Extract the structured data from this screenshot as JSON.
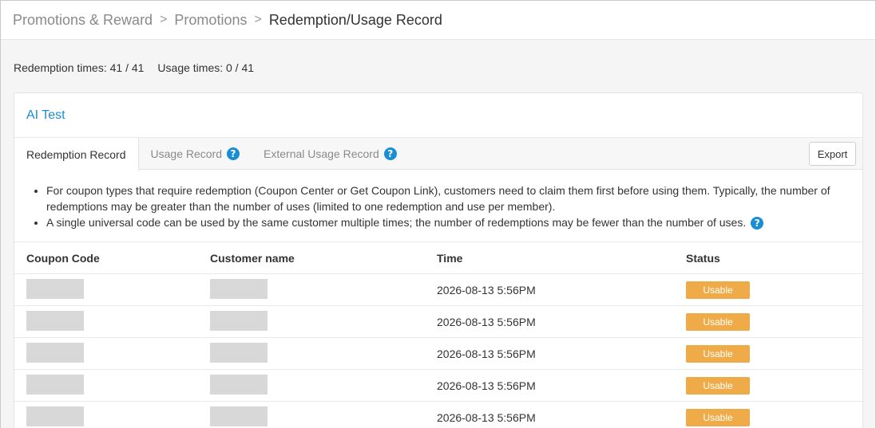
{
  "breadcrumb": {
    "items": [
      "Promotions & Reward",
      "Promotions",
      "Redemption/Usage Record"
    ],
    "separator": ">"
  },
  "summary": {
    "redemption": "Redemption times: 41 / 41",
    "usage": "Usage times: 0 / 41"
  },
  "card": {
    "title": "AI Test",
    "tabs": [
      {
        "label": "Redemption Record",
        "active": true,
        "help": false
      },
      {
        "label": "Usage Record",
        "active": false,
        "help": true
      },
      {
        "label": "External Usage Record",
        "active": false,
        "help": true
      }
    ],
    "export_label": "Export",
    "notes": [
      "For coupon types that require redemption (Coupon Center or Get Coupon Link), customers need to claim them first before using them. Typically, the number of redemptions may be greater than the number of uses (limited to one redemption and use per member).",
      "A single universal code can be used by the same customer multiple times; the number of redemptions may be fewer than the number of uses."
    ]
  },
  "table": {
    "columns": [
      "Coupon Code",
      "Customer name",
      "Time",
      "Status"
    ],
    "rows": [
      {
        "time": "2026-08-13 5:56PM",
        "status": "Usable"
      },
      {
        "time": "2026-08-13 5:56PM",
        "status": "Usable"
      },
      {
        "time": "2026-08-13 5:56PM",
        "status": "Usable"
      },
      {
        "time": "2026-08-13 5:56PM",
        "status": "Usable"
      },
      {
        "time": "2026-08-13 5:56PM",
        "status": "Usable"
      }
    ]
  },
  "colors": {
    "accent": "#1a8ed4",
    "status_usable": "#efab48"
  },
  "icons": {
    "help": "question-circle-icon"
  }
}
